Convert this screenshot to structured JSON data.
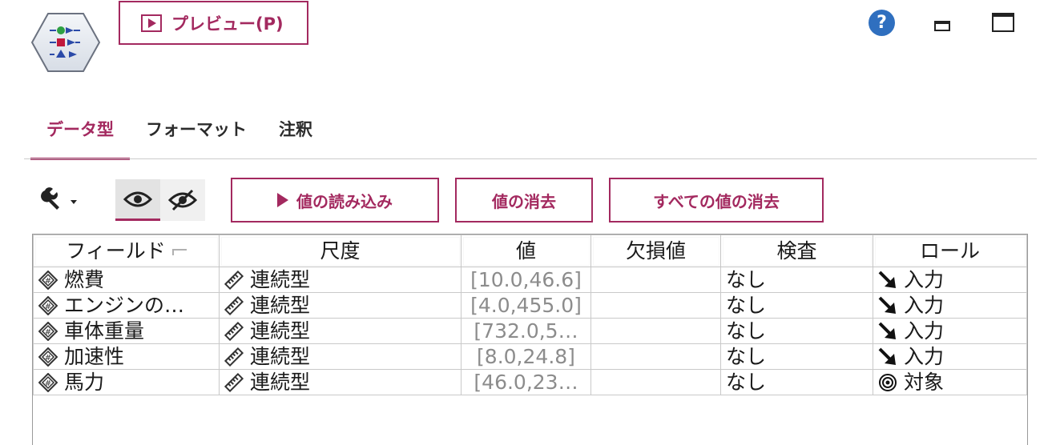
{
  "toolbar": {
    "preview_label": "プレビュー(P)",
    "help_glyph": "?"
  },
  "tabs": [
    {
      "label": "データ型",
      "active": true
    },
    {
      "label": "フォーマット",
      "active": false
    },
    {
      "label": "注釈",
      "active": false
    }
  ],
  "actions": {
    "read_values": "値の読み込み",
    "clear_values": "値の消去",
    "clear_all_values": "すべての値の消去"
  },
  "table": {
    "columns": [
      "フィールド",
      "尺度",
      "値",
      "欠損値",
      "検査",
      "ロール"
    ],
    "rows": [
      {
        "field": "燃費",
        "measure": "連続型",
        "values": "[10.0,46.6]",
        "missing": "",
        "check": "なし",
        "role": "入力",
        "role_icon": "arrow-input-icon"
      },
      {
        "field": "エンジンの…",
        "measure": "連続型",
        "values": "[4.0,455.0]",
        "missing": "",
        "check": "なし",
        "role": "入力",
        "role_icon": "arrow-input-icon"
      },
      {
        "field": "車体重量",
        "measure": "連続型",
        "values": "[732.0,5…",
        "missing": "",
        "check": "なし",
        "role": "入力",
        "role_icon": "arrow-input-icon"
      },
      {
        "field": "加速性",
        "measure": "連続型",
        "values": "[8.0,24.8]",
        "missing": "",
        "check": "なし",
        "role": "入力",
        "role_icon": "arrow-input-icon"
      },
      {
        "field": "馬力",
        "measure": "連続型",
        "values": "[46.0,23…",
        "missing": "",
        "check": "なし",
        "role": "対象",
        "role_icon": "target-icon"
      }
    ]
  },
  "colors": {
    "accent": "#a3295f",
    "help": "#2f6fbf"
  }
}
